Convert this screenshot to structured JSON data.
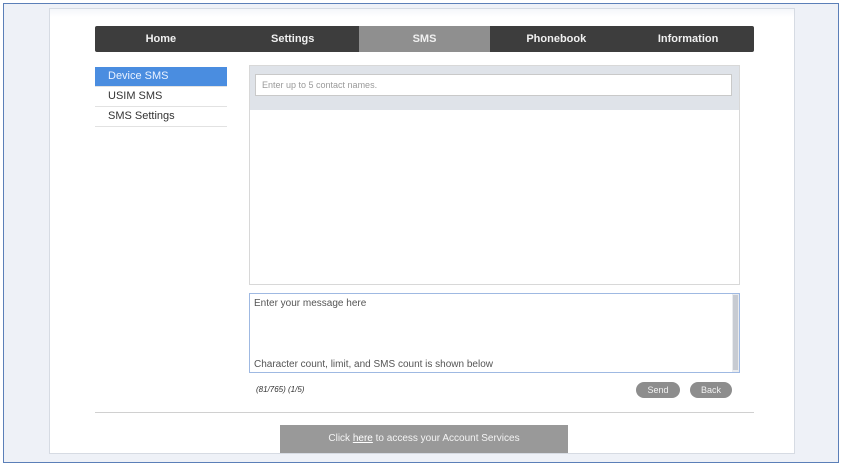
{
  "nav": {
    "tabs": [
      {
        "label": "Home"
      },
      {
        "label": "Settings"
      },
      {
        "label": "SMS"
      },
      {
        "label": "Phonebook"
      },
      {
        "label": "Information"
      }
    ],
    "active_tab": "SMS"
  },
  "sidebar": {
    "items": [
      {
        "label": "Device SMS"
      },
      {
        "label": "USIM SMS"
      },
      {
        "label": "SMS Settings"
      }
    ],
    "active_item": "Device SMS"
  },
  "recipients": {
    "placeholder": "Enter up to 5 contact names."
  },
  "message": {
    "line1": "Enter your message here",
    "line2": "Character count, limit, and SMS count is shown below"
  },
  "counter": {
    "text": "(81/765) (1/5)"
  },
  "buttons": {
    "send": "Send",
    "back": "Back"
  },
  "footer": {
    "prefix": "Click ",
    "link": "here",
    "suffix": " to access your Account Services"
  },
  "colors": {
    "nav_bg": "#3d3d3d",
    "nav_active": "#8f8f8f",
    "sidebar_active": "#4a8de0",
    "button_bg": "#8d8d8d"
  }
}
